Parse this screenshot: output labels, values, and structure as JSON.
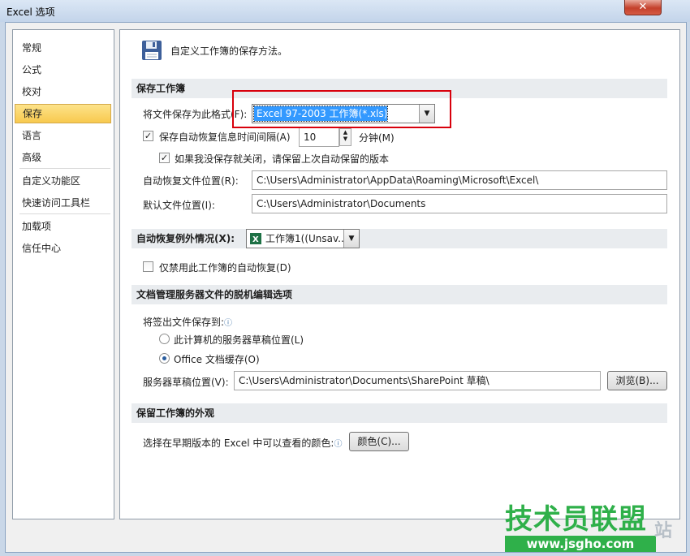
{
  "window": {
    "title": "Excel 选项",
    "close_label": "✕"
  },
  "nav": {
    "items": [
      {
        "label": "常规"
      },
      {
        "label": "公式"
      },
      {
        "label": "校对"
      },
      {
        "label": "保存",
        "selected": true
      },
      {
        "label": "语言"
      },
      {
        "label": "高级"
      },
      {
        "label": "自定义功能区"
      },
      {
        "label": "快速访问工具栏"
      },
      {
        "label": "加载项"
      },
      {
        "label": "信任中心"
      }
    ]
  },
  "header": {
    "text": "自定义工作簿的保存方法。",
    "icon": "floppy-disk-icon"
  },
  "save_workbooks": {
    "title": "保存工作簿",
    "format_label": "将文件保存为此格式(F):",
    "format_value": "Excel 97-2003 工作簿(*.xls)",
    "autorecover_label": "保存自动恢复信息时间间隔(A)",
    "autorecover_checked": true,
    "autorecover_minutes": "10",
    "minutes_label": "分钟(M)",
    "keep_last_label": "如果我没保存就关闭，请保留上次自动保留的版本",
    "keep_last_checked": true,
    "autorecover_location_label": "自动恢复文件位置(R):",
    "autorecover_location_value": "C:\\Users\\Administrator\\AppData\\Roaming\\Microsoft\\Excel\\",
    "default_location_label": "默认文件位置(I):",
    "default_location_value": "C:\\Users\\Administrator\\Documents"
  },
  "autorecover_exceptions": {
    "title": "自动恢复例外情况(X):",
    "workbook_value": "工作簿1((Unsav...",
    "disable_label": "仅禁用此工作簿的自动恢复(D)",
    "disable_checked": false
  },
  "offline_editing": {
    "title": "文档管理服务器文件的脱机编辑选项",
    "save_to_label": "将签出文件保存到:",
    "option_server_label": "此计算机的服务器草稿位置(L)",
    "option_office_label": "Office 文档缓存(O)",
    "selected_option": "office",
    "drafts_location_label": "服务器草稿位置(V):",
    "drafts_location_value": "C:\\Users\\Administrator\\Documents\\SharePoint 草稿\\",
    "browse_label": "浏览(B)..."
  },
  "appearance": {
    "title": "保留工作簿的外观",
    "colors_label": "选择在早期版本的 Excel 中可以查看的颜色:",
    "colors_button": "颜色(C)..."
  },
  "watermark": {
    "line1": "技术员联盟",
    "line2": "www.jsgho.com",
    "line3": "站"
  },
  "colors": {
    "selected_nav": "#f8c94e",
    "highlight": "#3399ff",
    "annotation_box": "#d8000c",
    "watermark": "#2fb04a"
  }
}
